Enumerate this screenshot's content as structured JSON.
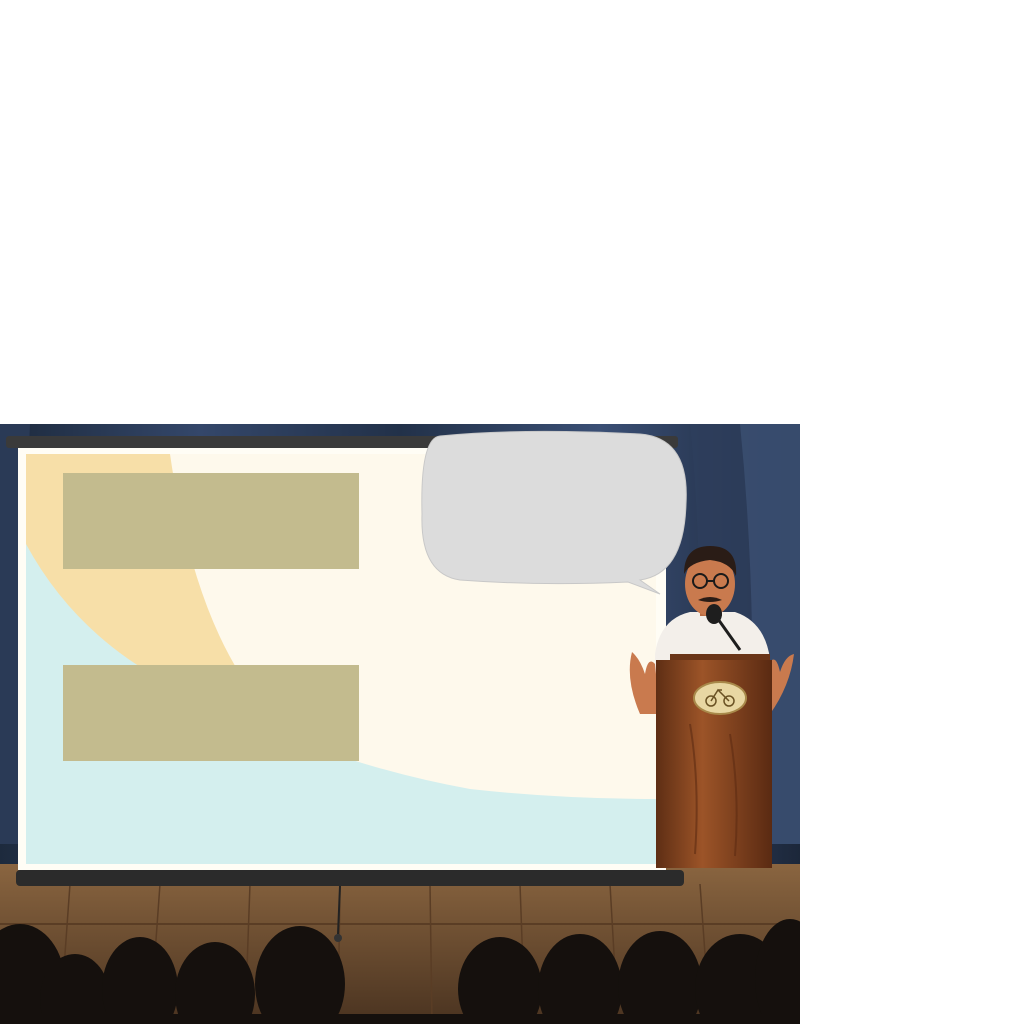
{
  "scene": {
    "colors": {
      "background": "#ffffff",
      "curtain": "#2b3a52",
      "stage_floor": "#7a5536",
      "screen_surface": "#fef9ec",
      "screen_band_yellow": "#f7dfa8",
      "screen_band_blue": "#d4efee",
      "text_placeholder_box": "#c3bb8e",
      "speech_bubble": "#dcdcdc",
      "podium_wood": "#8a4a22",
      "podium_emblem": "#e8d7a3",
      "speaker_shirt": "#f3efea",
      "speaker_skin": "#c97a4e",
      "speaker_hair": "#2a1c16",
      "audience_silhouette": "#15100d"
    },
    "icons": {
      "emblem": "bicycle-emblem-icon",
      "microphone": "microphone-icon"
    }
  }
}
